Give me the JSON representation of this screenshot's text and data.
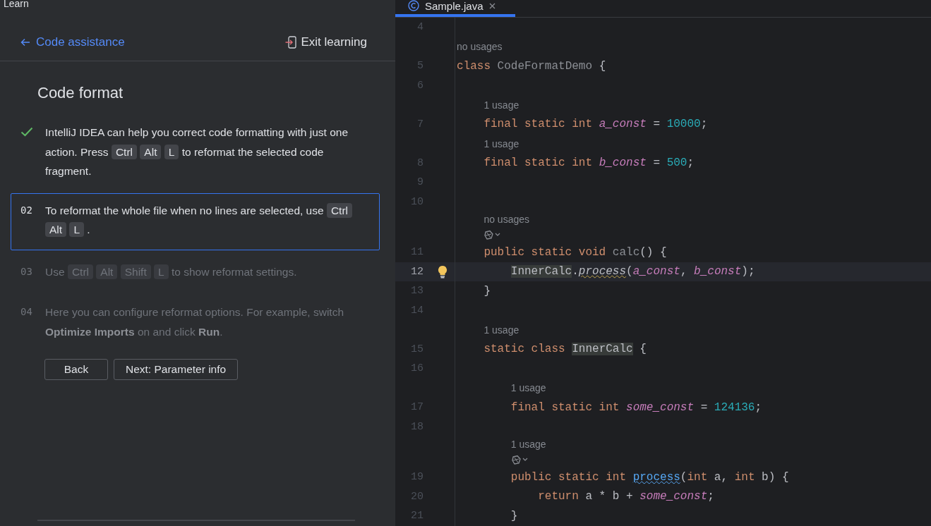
{
  "panel": {
    "title": "Learn",
    "back_link": "Code assistance",
    "exit_button": "Exit learning",
    "lesson_title": "Code format",
    "steps": [
      {
        "kind": "done",
        "parts": [
          {
            "kind": "text",
            "text": "IntelliJ IDEA can help you correct code formatting with just one action. Press"
          },
          {
            "kind": "key",
            "text": "Ctrl"
          },
          {
            "kind": "key",
            "text": "Alt"
          },
          {
            "kind": "key",
            "text": "L"
          },
          {
            "kind": "text",
            "text": "to reformat the selected code fragment."
          }
        ]
      },
      {
        "kind": "current",
        "number": "02",
        "parts": [
          {
            "kind": "text",
            "text": "To reformat the whole file when no lines are selected, use"
          },
          {
            "kind": "key",
            "text": "Ctrl"
          },
          {
            "kind": "key",
            "text": "Alt"
          },
          {
            "kind": "key",
            "text": "L"
          },
          {
            "kind": "text",
            "text": "."
          }
        ]
      },
      {
        "kind": "upcoming",
        "number": "03",
        "parts": [
          {
            "kind": "text",
            "text": "Use"
          },
          {
            "kind": "key",
            "text": "Ctrl"
          },
          {
            "kind": "key",
            "text": "Alt"
          },
          {
            "kind": "key",
            "text": "Shift"
          },
          {
            "kind": "key",
            "text": "L"
          },
          {
            "kind": "text",
            "text": "to show reformat settings."
          }
        ]
      },
      {
        "kind": "upcoming",
        "number": "04",
        "parts": [
          {
            "kind": "text",
            "text": "Here you can configure reformat options. For example, switch **Optimize Imports** on and click **Run**."
          }
        ]
      }
    ],
    "buttons": [
      "Back",
      "Next: Parameter info"
    ]
  },
  "editor": {
    "tab": {
      "label": "Sample.java",
      "selected": true
    },
    "lines": [
      {
        "kind": "code",
        "number": "4",
        "current": false
      },
      {
        "kind": "hint",
        "text": "no usages"
      },
      {
        "kind": "code",
        "number": "5",
        "current": false,
        "tokens": [
          {
            "kind": "keyword",
            "text": "class "
          },
          {
            "kind": "unused",
            "text": "CodeFormatDemo"
          },
          {
            "kind": "plain",
            "text": " {"
          }
        ],
        "children": [
          {
            "kind": "code",
            "number": "6",
            "current": false
          },
          {
            "kind": "hint",
            "text": "1 usage"
          },
          {
            "kind": "code",
            "number": "7",
            "current": false,
            "tokens": [
              {
                "kind": "keyword",
                "text": "final static int "
              },
              {
                "kind": "field",
                "text": "a_const"
              },
              {
                "kind": "plain",
                "text": " = "
              },
              {
                "kind": "number",
                "text": "10000"
              },
              {
                "kind": "plain",
                "text": ";"
              }
            ]
          },
          {
            "kind": "hint",
            "text": "1 usage"
          },
          {
            "kind": "code",
            "number": "8",
            "current": false,
            "tokens": [
              {
                "kind": "keyword",
                "text": "final static int "
              },
              {
                "kind": "field",
                "text": "b_const"
              },
              {
                "kind": "plain",
                "text": " = "
              },
              {
                "kind": "number",
                "text": "500"
              },
              {
                "kind": "plain",
                "text": ";"
              }
            ]
          },
          {
            "kind": "code",
            "number": "9",
            "current": false
          },
          {
            "kind": "code",
            "number": "10",
            "current": false
          },
          {
            "kind": "hint",
            "text": "no usages",
            "ai_icon": true
          },
          {
            "kind": "code",
            "number": "11",
            "current": false,
            "tokens": [
              {
                "kind": "keyword",
                "text": "public static void "
              },
              {
                "kind": "unused",
                "text": "calc"
              },
              {
                "kind": "plain",
                "text": "() {"
              }
            ],
            "children": [
              {
                "kind": "code",
                "number": "12",
                "current": true,
                "tokens": [
                  {
                    "kind": "highlight",
                    "text": "InnerCalc"
                  },
                  {
                    "kind": "plain",
                    "text": "."
                  },
                  {
                    "kind": "call",
                    "text": "process"
                  },
                  {
                    "kind": "plain",
                    "text": "("
                  },
                  {
                    "kind": "field",
                    "text": "a_const"
                  },
                  {
                    "kind": "plain",
                    "text": ", "
                  },
                  {
                    "kind": "field",
                    "text": "b_const"
                  },
                  {
                    "kind": "plain",
                    "text": ");"
                  }
                ]
              }
            ]
          },
          {
            "kind": "code",
            "number": "13",
            "current": false,
            "tokens": [
              {
                "kind": "plain",
                "text": "}"
              }
            ]
          },
          {
            "kind": "code",
            "number": "14",
            "current": false
          },
          {
            "kind": "hint",
            "text": "1 usage"
          },
          {
            "kind": "code",
            "number": "15",
            "current": false,
            "tokens": [
              {
                "kind": "keyword",
                "text": "static class "
              },
              {
                "kind": "highlight",
                "text": "InnerCalc"
              },
              {
                "kind": "plain",
                "text": " {"
              }
            ],
            "children": [
              {
                "kind": "code",
                "number": "16",
                "current": false
              },
              {
                "kind": "hint",
                "text": "1 usage"
              },
              {
                "kind": "code",
                "number": "17",
                "current": false,
                "tokens": [
                  {
                    "kind": "keyword",
                    "text": "final static int "
                  },
                  {
                    "kind": "field",
                    "text": "some_const"
                  },
                  {
                    "kind": "plain",
                    "text": " = "
                  },
                  {
                    "kind": "number",
                    "text": "124136"
                  },
                  {
                    "kind": "plain",
                    "text": ";"
                  }
                ]
              },
              {
                "kind": "code",
                "number": "18",
                "current": false
              },
              {
                "kind": "hint",
                "text": "1 usage",
                "ai_icon": true
              },
              {
                "kind": "code",
                "number": "19",
                "current": false,
                "tokens": [
                  {
                    "kind": "keyword",
                    "text": "public static int "
                  },
                  {
                    "kind": "declaration",
                    "text": "process"
                  },
                  {
                    "kind": "plain",
                    "text": "("
                  },
                  {
                    "kind": "keyword",
                    "text": "int "
                  },
                  {
                    "kind": "plain",
                    "text": "a, "
                  },
                  {
                    "kind": "keyword",
                    "text": "int "
                  },
                  {
                    "kind": "plain",
                    "text": "b) {"
                  }
                ],
                "children": [
                  {
                    "kind": "code",
                    "number": "20",
                    "current": false,
                    "tokens": [
                      {
                        "kind": "keyword",
                        "text": "return "
                      },
                      {
                        "kind": "plain",
                        "text": "a * b + "
                      },
                      {
                        "kind": "field",
                        "text": "some_const"
                      },
                      {
                        "kind": "plain",
                        "text": ";"
                      }
                    ]
                  }
                ]
              },
              {
                "kind": "code",
                "number": "21",
                "current": false,
                "tokens": [
                  {
                    "kind": "plain",
                    "text": "}"
                  }
                ]
              }
            ]
          }
        ]
      }
    ]
  }
}
